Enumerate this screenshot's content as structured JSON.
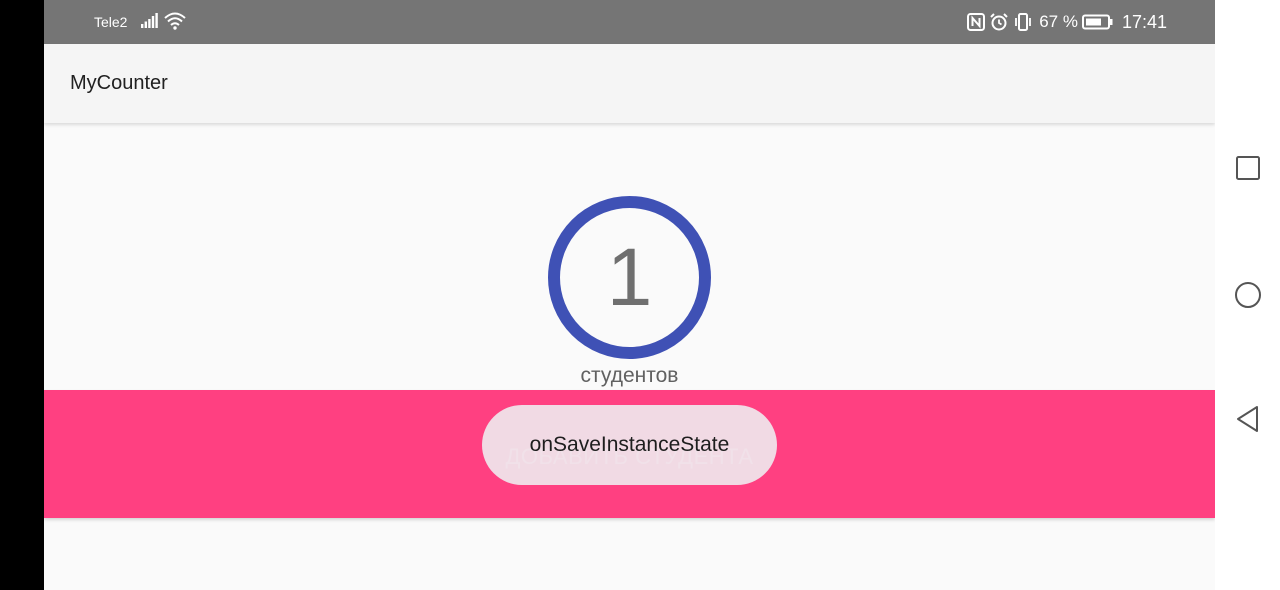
{
  "status_bar": {
    "carrier": "Tele2",
    "battery_percent": "67 %",
    "time": "17:41",
    "icons": [
      "signal-icon",
      "wifi-icon",
      "nfc-icon",
      "alarm-icon",
      "vibrate-icon",
      "battery-icon"
    ]
  },
  "app_bar": {
    "title": "MyCounter"
  },
  "counter": {
    "value": "1",
    "caption": "студентов",
    "ring_color": "#3f51b5"
  },
  "add_button": {
    "label": "ДОБАВИТЬ СТУДЕНТА",
    "color": "#ff4081"
  },
  "toast": {
    "message": "onSaveInstanceState"
  },
  "nav_bar": {
    "buttons": [
      "recents-icon",
      "home-icon",
      "back-icon"
    ]
  }
}
